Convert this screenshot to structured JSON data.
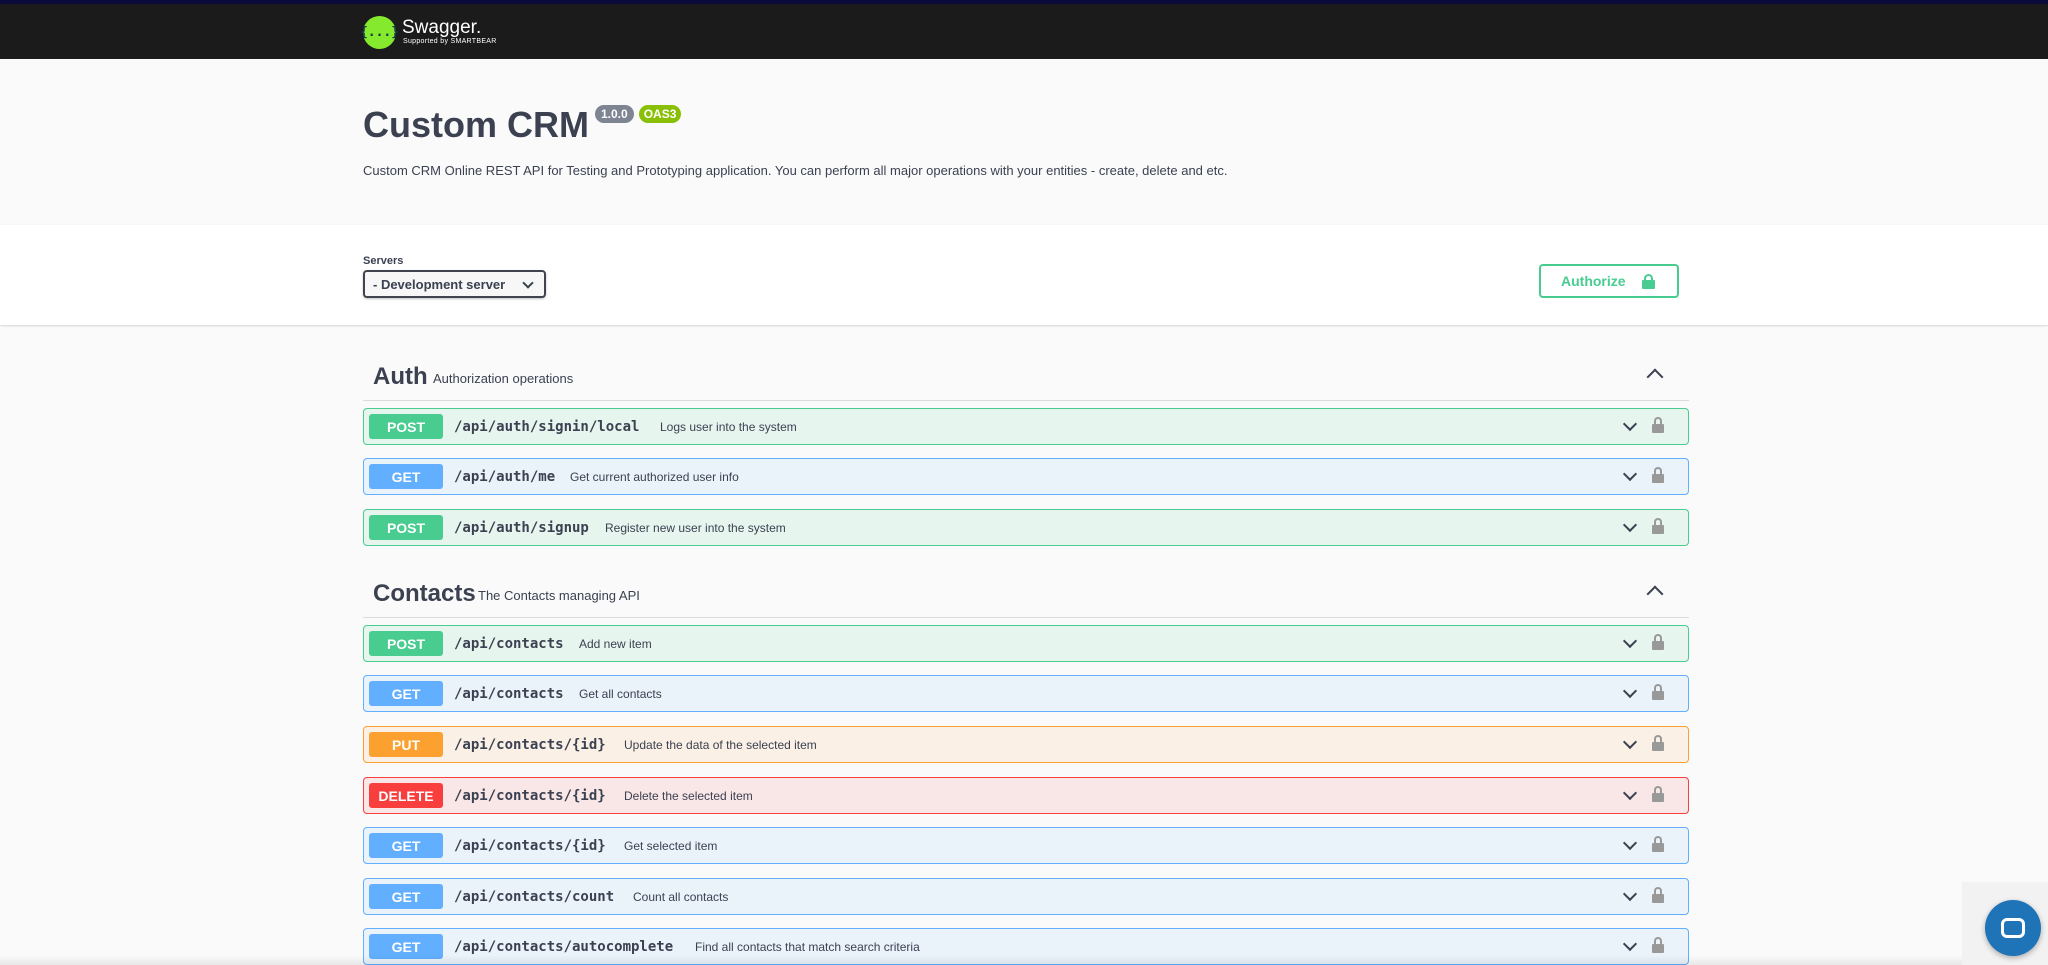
{
  "topbar": {
    "logo_glyph": "{...}",
    "logo_name": "Swagger.",
    "logo_sub": "Supported by SMARTBEAR"
  },
  "info": {
    "title": "Custom CRM",
    "version": "1.0.0",
    "oas": "OAS3",
    "description": "Custom CRM Online REST API for Testing and Prototyping application. You can perform all major operations with your entities - create, delete and etc."
  },
  "servers": {
    "label": "Servers",
    "selected": "- Development server"
  },
  "authorize": {
    "label": "Authorize"
  },
  "tags": [
    {
      "name": "Auth",
      "description": "Authorization operations",
      "operations": [
        {
          "method": "POST",
          "path": "/api/auth/signin/local",
          "summary": "Logs user into the system"
        },
        {
          "method": "GET",
          "path": "/api/auth/me",
          "summary": "Get current authorized user info"
        },
        {
          "method": "POST",
          "path": "/api/auth/signup",
          "summary": "Register new user into the system"
        }
      ]
    },
    {
      "name": "Contacts",
      "description": "The Contacts managing API",
      "operations": [
        {
          "method": "POST",
          "path": "/api/contacts",
          "summary": "Add new item"
        },
        {
          "method": "GET",
          "path": "/api/contacts",
          "summary": "Get all contacts"
        },
        {
          "method": "PUT",
          "path": "/api/contacts/{id}",
          "summary": "Update the data of the selected item"
        },
        {
          "method": "DELETE",
          "path": "/api/contacts/{id}",
          "summary": "Delete the selected item"
        },
        {
          "method": "GET",
          "path": "/api/contacts/{id}",
          "summary": "Get selected item"
        },
        {
          "method": "GET",
          "path": "/api/contacts/count",
          "summary": "Count all contacts"
        },
        {
          "method": "GET",
          "path": "/api/contacts/autocomplete",
          "summary": "Find all contacts that match search criteria"
        }
      ]
    }
  ],
  "colors": {
    "post": "#49cc90",
    "get": "#61affe",
    "put": "#fca130",
    "delete": "#f93e3e"
  }
}
